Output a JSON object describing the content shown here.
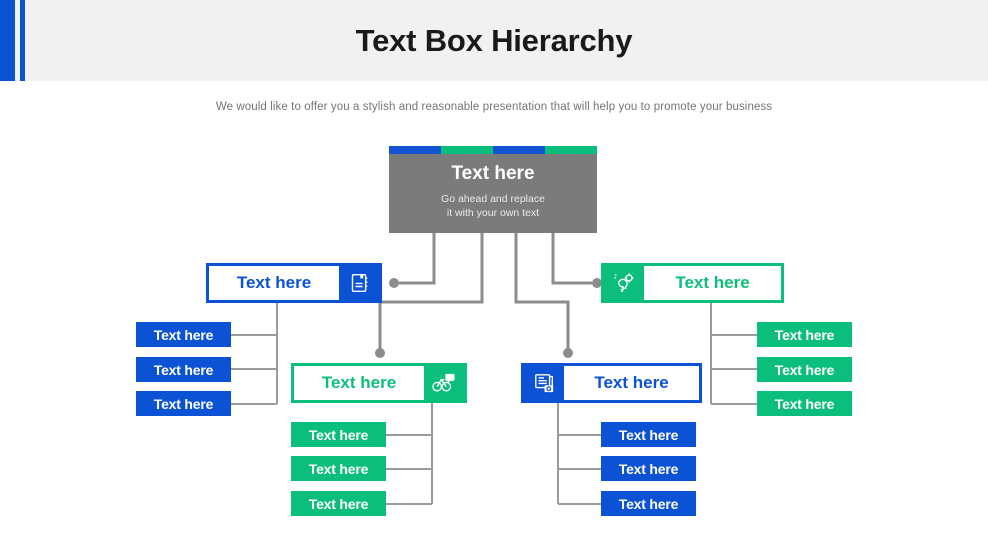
{
  "header": {
    "title": "Text Box Hierarchy",
    "subtitle": "We would like to offer you a stylish and reasonable presentation that will help you to promote your business"
  },
  "colors": {
    "blue": "#0b52d4",
    "green": "#0cbe7b",
    "hub_gray": "#7b7b7b",
    "band_gray": "#f1f1f1",
    "connector_gray": "#8c8c8c",
    "title_text": "#1a1a1a",
    "subtitle_text": "#757575"
  },
  "hub": {
    "title": "Text here",
    "subtitle_line1": "Go ahead and replace",
    "subtitle_line2": "it with your own  text",
    "strip_segments": [
      "blue",
      "green",
      "blue",
      "green"
    ]
  },
  "nodes": [
    {
      "id": "left",
      "label": "Text here",
      "color": "blue",
      "icon": "notebook-icon",
      "icon_side": "right"
    },
    {
      "id": "right",
      "label": "Text here",
      "color": "green",
      "icon": "lightbulb-gear-icon",
      "icon_side": "left"
    },
    {
      "id": "mid-l",
      "label": "Text here",
      "color": "green",
      "icon": "bicycle-chat-icon",
      "icon_side": "right"
    },
    {
      "id": "mid-r",
      "label": "Text here",
      "color": "blue",
      "icon": "document-photo-icon",
      "icon_side": "left"
    }
  ],
  "leaves": {
    "left": [
      {
        "label": "Text here"
      },
      {
        "label": "Text here"
      },
      {
        "label": "Text here"
      }
    ],
    "right": [
      {
        "label": "Text here"
      },
      {
        "label": "Text here"
      },
      {
        "label": "Text here"
      }
    ],
    "mid_left": [
      {
        "label": "Text here"
      },
      {
        "label": "Text here"
      },
      {
        "label": "Text here"
      }
    ],
    "mid_right": [
      {
        "label": "Text here"
      },
      {
        "label": "Text here"
      },
      {
        "label": "Text here"
      }
    ]
  }
}
